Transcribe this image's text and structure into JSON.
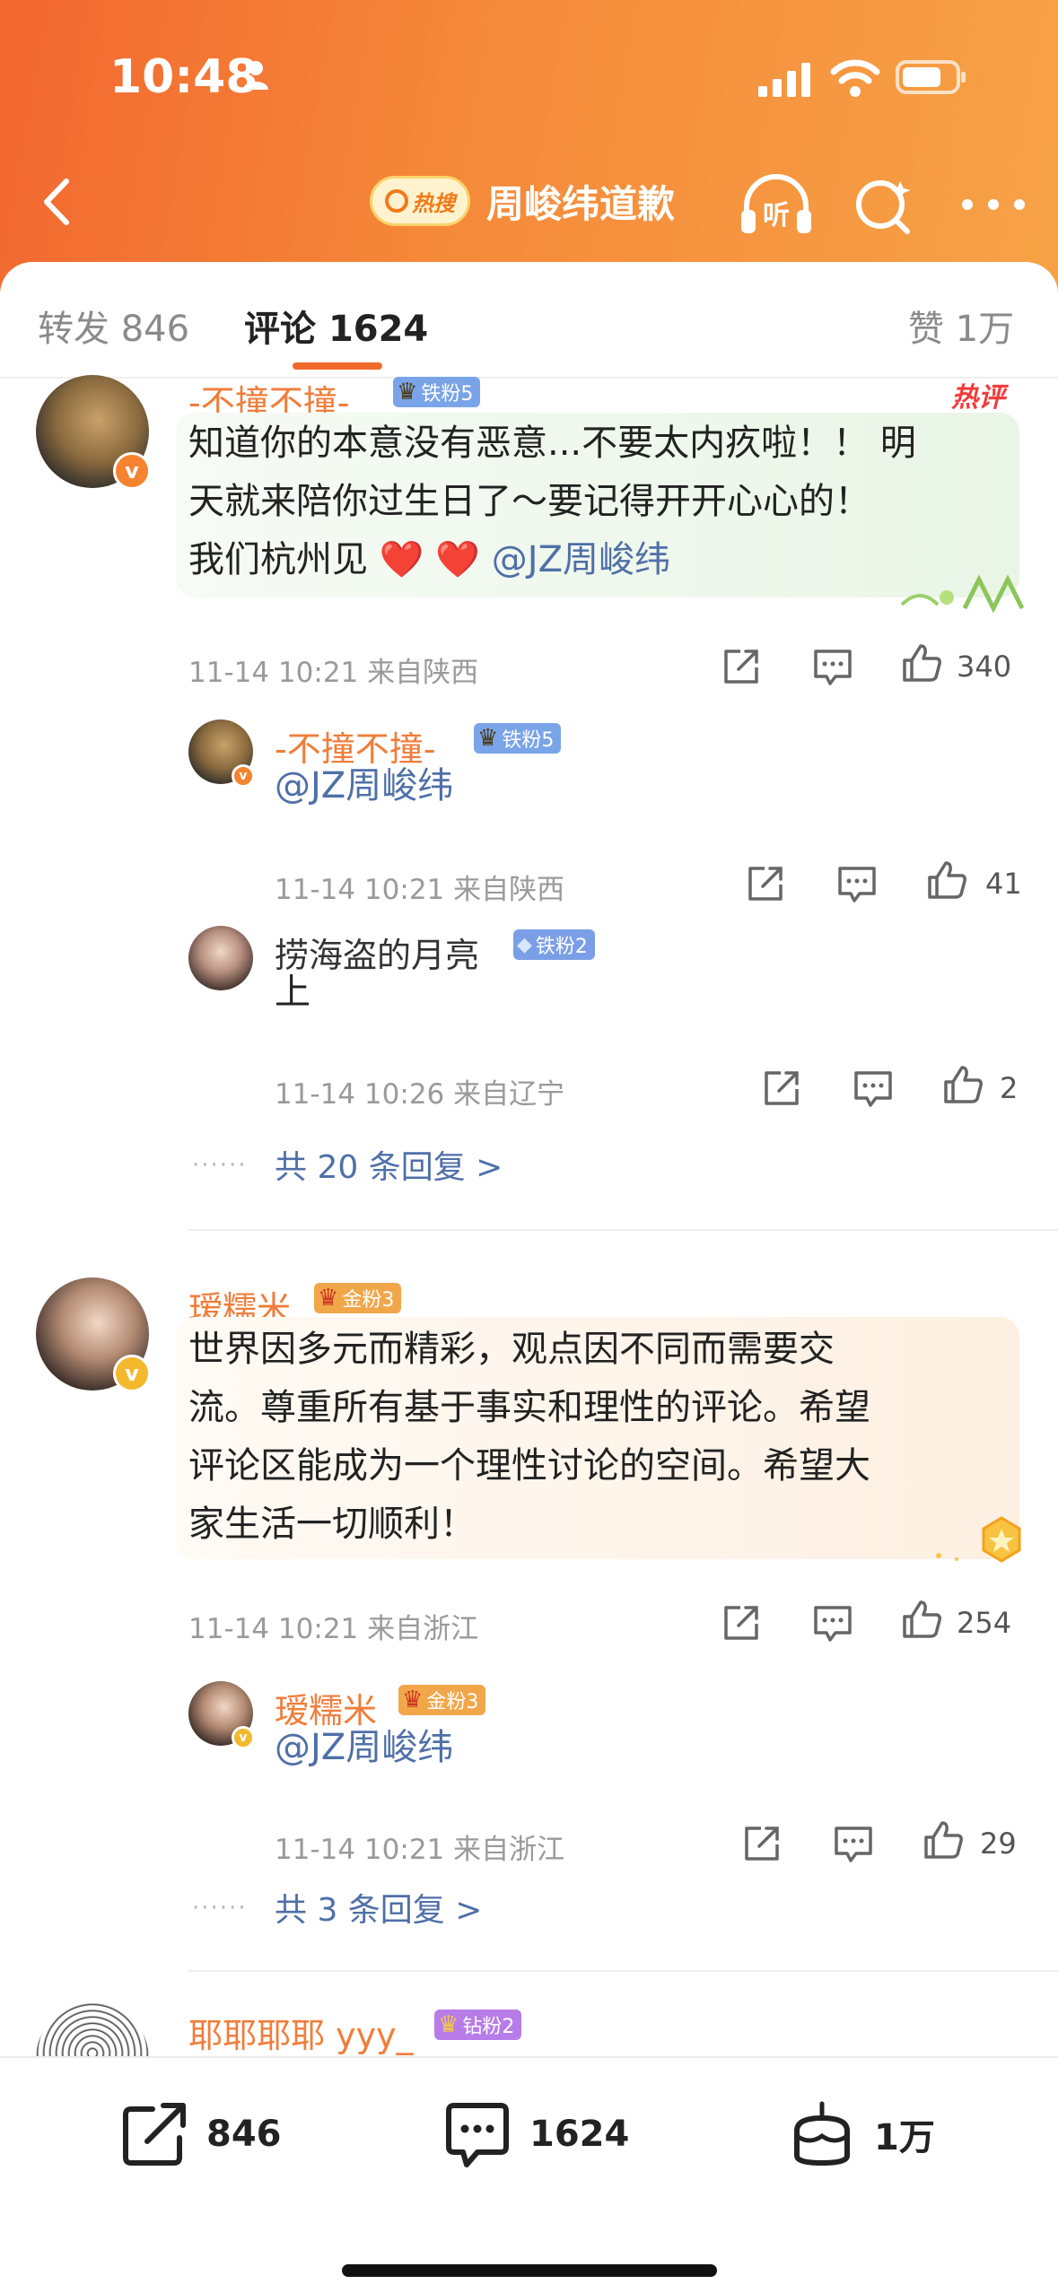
{
  "status_bar": {
    "time": "10:48"
  },
  "navbar": {
    "hot_badge": "热搜",
    "title": "周峻纬道歉"
  },
  "tabs": [
    {
      "label": "转发",
      "count": "846"
    },
    {
      "label": "评论",
      "count": "1624"
    },
    {
      "label": "赞",
      "count": "1万"
    }
  ],
  "comments": [
    {
      "username": "-不撞不撞-",
      "badge": "铁粉5",
      "hot_tag": "热评",
      "text_line1": "知道你的本意没有恶意...不要太内疚啦！！ 明",
      "text_line2": "天就来陪你过生日了～要记得开开心心的！",
      "text_line3": "我们杭州见 ❤️ ❤️ ",
      "mention": "@JZ周峻纬",
      "meta": "11-14 10:21 来自陕西",
      "likes": "340",
      "replies": [
        {
          "username": "-不撞不撞-",
          "badge": "铁粉5",
          "text": "@JZ周峻纬",
          "meta": "11-14 10:21 来自陕西",
          "likes": "41"
        },
        {
          "username": "捞海盗的月亮",
          "badge": "铁粉2",
          "text": "上",
          "meta": "11-14 10:26 来自辽宁",
          "likes": "2"
        }
      ],
      "more_replies": "共 20 条回复 >"
    },
    {
      "username": "瑷糯米",
      "badge": "金粉3",
      "text_line1": "世界因多元而精彩，观点因不同而需要交",
      "text_line2": "流。尊重所有基于事实和理性的评论。希望",
      "text_line3": "评论区能成为一个理性讨论的空间。希望大",
      "text_line4": "家生活一切顺利！",
      "meta": "11-14 10:21 来自浙江",
      "likes": "254",
      "replies": [
        {
          "username": "瑷糯米",
          "badge": "金粉3",
          "text": "@JZ周峻纬",
          "meta": "11-14 10:21 来自浙江",
          "likes": "29"
        }
      ],
      "more_replies": "共 3 条回复 >"
    },
    {
      "username": "耶耶耶耶 yyy_",
      "badge": "钻粉2"
    }
  ],
  "bottom_bar": {
    "repost_count": "846",
    "comment_count": "1624",
    "like_count": "1万"
  },
  "colors": {
    "header_start": "#f2672f",
    "header_end": "#f7a246",
    "username": "#f07d3a",
    "mention": "#4f6fa8",
    "accent": "#f26a2a"
  }
}
